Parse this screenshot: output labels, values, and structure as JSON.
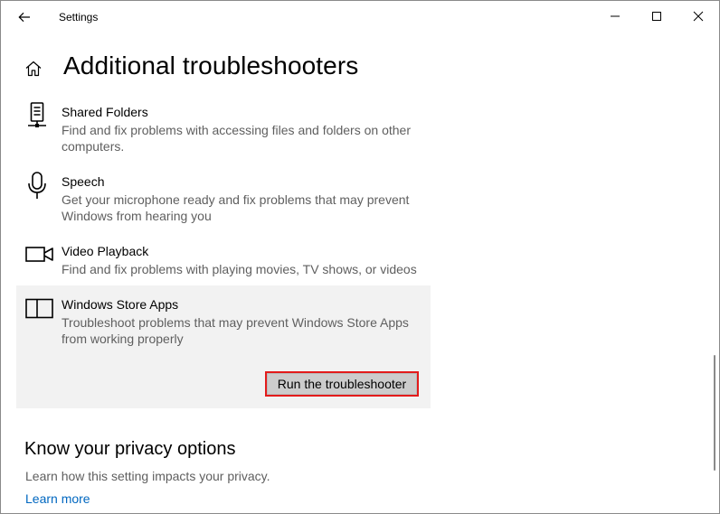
{
  "window": {
    "title": "Settings"
  },
  "header": {
    "title": "Additional troubleshooters"
  },
  "troubleshooters": [
    {
      "name": "Shared Folders",
      "description": "Find and fix problems with accessing files and folders on other computers.",
      "icon": "network-drive-icon"
    },
    {
      "name": "Speech",
      "description": "Get your microphone ready and fix problems that may prevent Windows from hearing you",
      "icon": "microphone-icon"
    },
    {
      "name": "Video Playback",
      "description": "Find and fix problems with playing movies, TV shows, or videos",
      "icon": "video-camera-icon"
    },
    {
      "name": "Windows Store Apps",
      "description": "Troubleshoot problems that may prevent Windows Store Apps from working properly",
      "icon": "store-apps-icon",
      "selected": true,
      "button_label": "Run the troubleshooter"
    }
  ],
  "privacy": {
    "heading": "Know your privacy options",
    "description": "Learn how this setting impacts your privacy.",
    "link": "Learn more"
  },
  "colors": {
    "accent": "#0067c0",
    "highlight_border": "#e31b1b",
    "selected_bg": "#f2f2f2"
  }
}
